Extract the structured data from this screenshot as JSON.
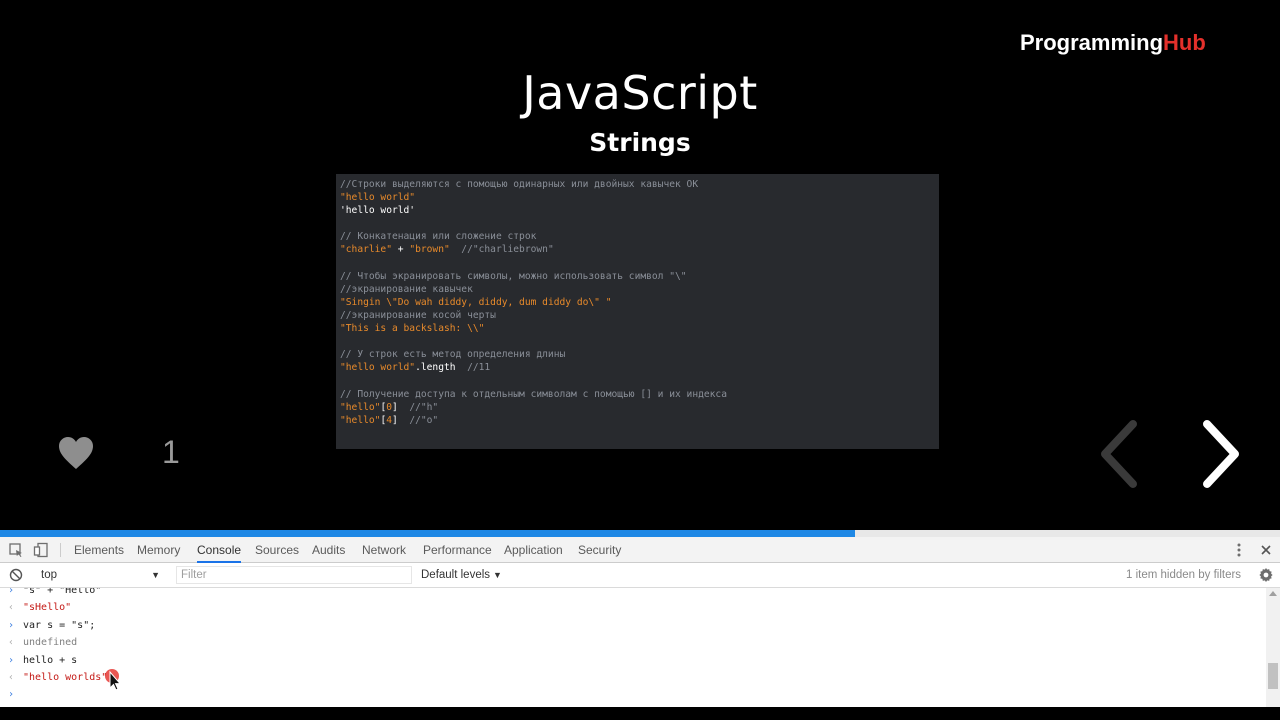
{
  "brand": {
    "part1": "Programming",
    "part2": "Hub"
  },
  "slide": {
    "title": "JavaScript",
    "subtitle": "Strings",
    "code_lines": [
      [
        {
          "t": "//Строки выделяются с помощью одинарных или двойных кавычек ОК",
          "c": "com"
        }
      ],
      [
        {
          "t": "\"hello world\"",
          "c": "str"
        }
      ],
      [
        {
          "t": "'hello world'",
          "c": "txt"
        }
      ],
      [
        {
          "t": "",
          "c": "txt"
        }
      ],
      [
        {
          "t": "// Конкатенация или сложение строк",
          "c": "com"
        }
      ],
      [
        {
          "t": "\"charlie\"",
          "c": "str"
        },
        {
          "t": " + ",
          "c": "txt"
        },
        {
          "t": "\"brown\"",
          "c": "str"
        },
        {
          "t": "  //\"charliebrown\"",
          "c": "com"
        }
      ],
      [
        {
          "t": "",
          "c": "txt"
        }
      ],
      [
        {
          "t": "// Чтобы экранировать символы, можно использовать символ \"\\\"",
          "c": "com"
        }
      ],
      [
        {
          "t": "//экранирование кавычек",
          "c": "com"
        }
      ],
      [
        {
          "t": "\"Singin \\\"",
          "c": "str"
        },
        {
          "t": "Do wah diddy, diddy, dum diddy do",
          "c": "str"
        },
        {
          "t": "\\\" \"",
          "c": "str"
        }
      ],
      [
        {
          "t": "//экранирование косой черты",
          "c": "com"
        }
      ],
      [
        {
          "t": "\"This is a backslash: \\\\\"",
          "c": "str"
        }
      ],
      [
        {
          "t": "",
          "c": "txt"
        }
      ],
      [
        {
          "t": "// У строк есть метод определения длины",
          "c": "com"
        }
      ],
      [
        {
          "t": "\"hello world\"",
          "c": "str"
        },
        {
          "t": ".length",
          "c": "txt"
        },
        {
          "t": "  //11",
          "c": "com"
        }
      ],
      [
        {
          "t": "",
          "c": "txt"
        }
      ],
      [
        {
          "t": "// Получение доступа к отдельным символам с помощью [] и их индекса",
          "c": "com"
        }
      ],
      [
        {
          "t": "\"hello\"",
          "c": "str"
        },
        {
          "t": "[",
          "c": "txt"
        },
        {
          "t": "0",
          "c": "str"
        },
        {
          "t": "]",
          "c": "txt"
        },
        {
          "t": "  //\"h\"",
          "c": "com"
        }
      ],
      [
        {
          "t": "\"hello\"",
          "c": "str"
        },
        {
          "t": "[",
          "c": "txt"
        },
        {
          "t": "4",
          "c": "str"
        },
        {
          "t": "]",
          "c": "txt"
        },
        {
          "t": "  //\"o\"",
          "c": "com"
        }
      ]
    ]
  },
  "like": {
    "icon": "heart-icon",
    "count": "1"
  },
  "navigation": {
    "prev_icon": "chevron-left-icon",
    "next_icon": "chevron-right-icon"
  },
  "progress": {
    "fraction": 0.668,
    "fill_color": "#1e88e5"
  },
  "devtools": {
    "tabs": [
      {
        "label": "Elements",
        "active": false
      },
      {
        "label": "Memory",
        "active": false
      },
      {
        "label": "Console",
        "active": true
      },
      {
        "label": "Sources",
        "active": false
      },
      {
        "label": "Audits",
        "active": false
      },
      {
        "label": "Network",
        "active": false
      },
      {
        "label": "Performance",
        "active": false
      },
      {
        "label": "Application",
        "active": false
      },
      {
        "label": "Security",
        "active": false
      }
    ],
    "context": "top",
    "filter_placeholder": "Filter",
    "levels": "Default levels",
    "hidden_info": "1 item hidden by filters",
    "console": [
      {
        "kind": "in",
        "text": "\"s\" + \"Hello\"",
        "style": "in"
      },
      {
        "kind": "out",
        "text": "\"sHello\"",
        "style": "str"
      },
      {
        "kind": "in",
        "text": "var s = \"s\";",
        "style": "in"
      },
      {
        "kind": "out",
        "text": "undefined",
        "style": "undef"
      },
      {
        "kind": "in",
        "text": "hello + s",
        "style": "in"
      },
      {
        "kind": "out",
        "text": "\"hello worlds\"",
        "style": "str"
      },
      {
        "kind": "prompt",
        "text": "",
        "style": "in"
      }
    ]
  },
  "colors": {
    "brand_accent": "#e4302b",
    "code_string": "#e88a2b",
    "code_comment": "#8a8f98",
    "console_string": "#c41a16"
  }
}
